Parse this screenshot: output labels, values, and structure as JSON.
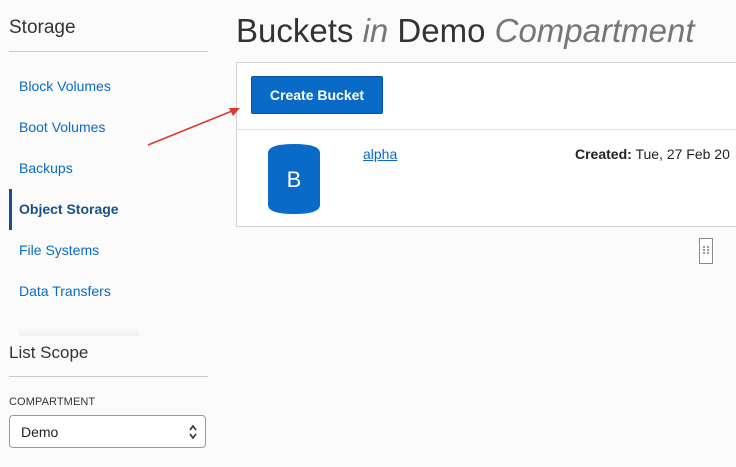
{
  "sidebar": {
    "title": "Storage",
    "items": [
      {
        "label": "Block Volumes",
        "active": false
      },
      {
        "label": "Boot Volumes",
        "active": false
      },
      {
        "label": "Backups",
        "active": false
      },
      {
        "label": "Object Storage",
        "active": true
      },
      {
        "label": "File Systems",
        "active": false
      },
      {
        "label": "Data Transfers",
        "active": false
      }
    ],
    "scope": {
      "title": "List Scope",
      "compartment_label": "COMPARTMENT",
      "compartment_value": "Demo"
    }
  },
  "main": {
    "title_part1": "Buckets",
    "title_in": "in",
    "title_part2": "Demo",
    "title_part3": "Compartment",
    "create_button": "Create Bucket",
    "buckets": [
      {
        "icon_letter": "B",
        "name": "alpha",
        "created_label": "Created:",
        "created_value": "Tue, 27 Feb 20"
      }
    ]
  },
  "colors": {
    "accent": "#0a6ac8",
    "nav_active": "#1b4f86",
    "annotation_arrow": "#e0382b"
  },
  "icons": {
    "bucket": "bucket-icon",
    "select": "chevron-updown-icon",
    "pager": "pagination-icon"
  }
}
